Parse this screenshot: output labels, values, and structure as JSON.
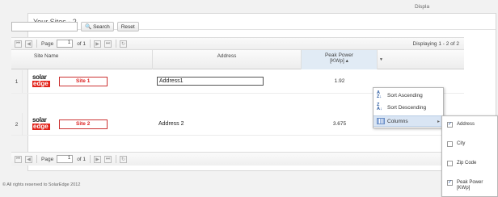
{
  "panel": {
    "title": "Your Sites - 2"
  },
  "search": {
    "value": "",
    "placeholder": "",
    "search_label": "Search",
    "reset_label": "Reset"
  },
  "pager": {
    "page_label": "Page",
    "page_value": "1",
    "of_label": "of 1",
    "display_text": "Displaying 1 - 2 of 2",
    "bottom_display_text": "Displa"
  },
  "columns": {
    "site_name": "Site Name",
    "address": "Address",
    "peak_power_line1": "Peak Power",
    "peak_power_line2": "[KWp] ▴"
  },
  "rows": [
    {
      "num": "1",
      "logo_top": "solar",
      "logo_bottom": "edge",
      "site": "Site 1",
      "address": "Address1",
      "peak": "1.92"
    },
    {
      "num": "2",
      "logo_top": "solar",
      "logo_bottom": "edge",
      "site": "Site 2",
      "address": "Address 2",
      "peak": "3.675"
    }
  ],
  "column_menu": {
    "sort_ascending": "Sort Ascending",
    "sort_descending": "Sort Descending",
    "columns": "Columns"
  },
  "columns_submenu": [
    {
      "label": "Address",
      "checked": true
    },
    {
      "label": "City",
      "checked": false
    },
    {
      "label": "Zip Code",
      "checked": false
    },
    {
      "label": "Peak Power [KWp]",
      "checked": true
    }
  ],
  "footer": {
    "text": "© All rights reserved to SolarEdge 2012"
  }
}
